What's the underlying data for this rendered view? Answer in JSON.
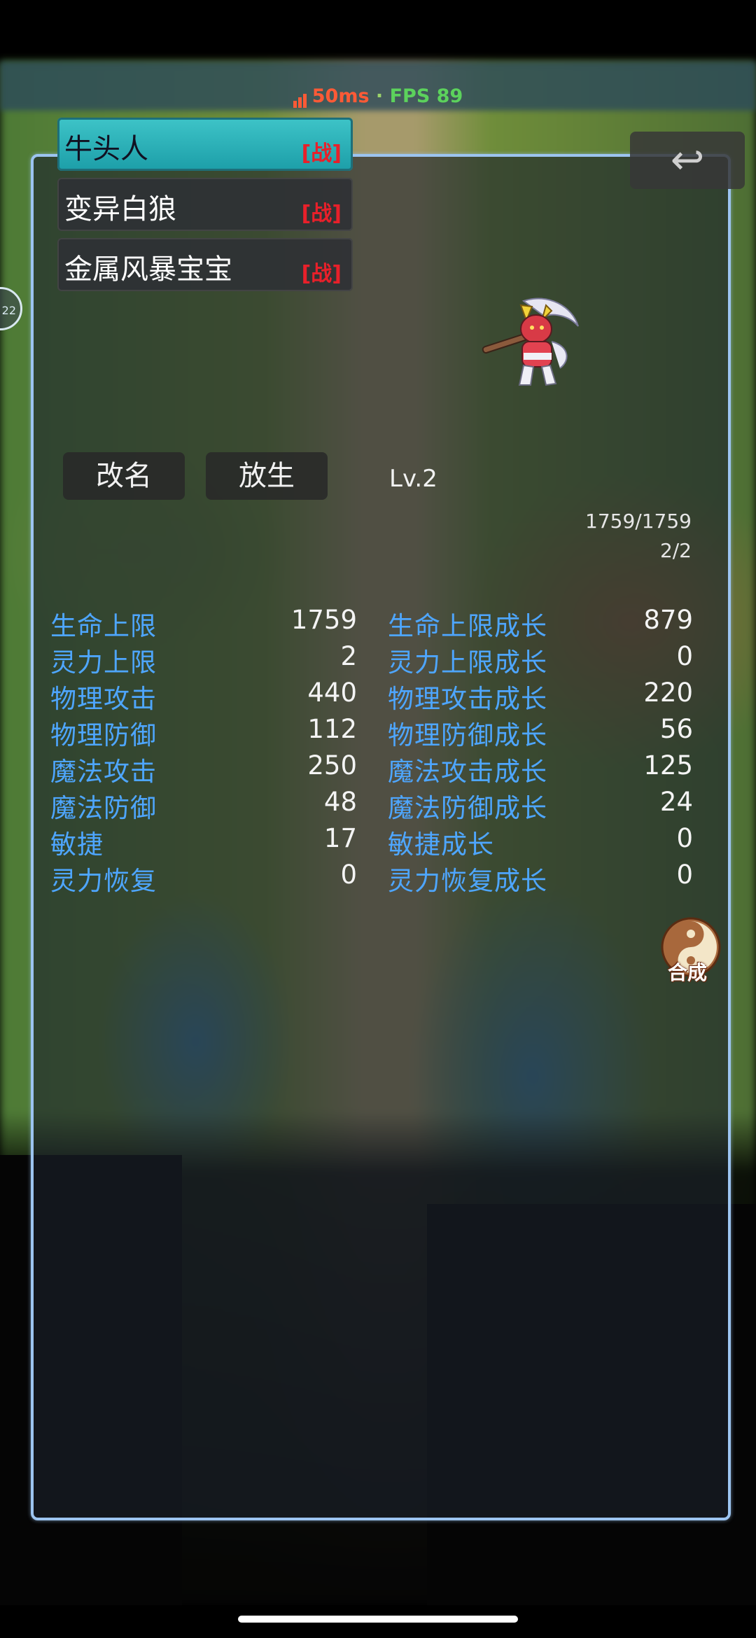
{
  "status": {
    "ping": "50ms",
    "separator": " · ",
    "fps": "FPS 89"
  },
  "pets": [
    {
      "name": "牛头人",
      "tag": "[战]",
      "active": true
    },
    {
      "name": "变异白狼",
      "tag": "[战]",
      "active": false
    },
    {
      "name": "金属风暴宝宝",
      "tag": "[战]",
      "active": false
    }
  ],
  "back_icon": "↩",
  "actions": {
    "rename": "改名",
    "release": "放生"
  },
  "level": "Lv.2",
  "hp_text": "1759/1759",
  "mp_text": "2/2",
  "stats": [
    {
      "label": "生命上限",
      "value": "1759",
      "growth_label": "生命上限成长",
      "growth_value": "879"
    },
    {
      "label": "灵力上限",
      "value": "2",
      "growth_label": "灵力上限成长",
      "growth_value": "0"
    },
    {
      "label": "物理攻击",
      "value": "440",
      "growth_label": "物理攻击成长",
      "growth_value": "220"
    },
    {
      "label": "物理防御",
      "value": "112",
      "growth_label": "物理防御成长",
      "growth_value": "56"
    },
    {
      "label": "魔法攻击",
      "value": "250",
      "growth_label": "魔法攻击成长",
      "growth_value": "125"
    },
    {
      "label": "魔法防御",
      "value": "48",
      "growth_label": "魔法防御成长",
      "growth_value": "24"
    },
    {
      "label": "敏捷",
      "value": "17",
      "growth_label": "敏捷成长",
      "growth_value": "0"
    },
    {
      "label": "灵力恢复",
      "value": "0",
      "growth_label": "灵力恢复成长",
      "growth_value": "0"
    }
  ],
  "synth_label": "合成",
  "left_edge_label": "22",
  "colors": {
    "panel_border": "#9cc4f0",
    "stat_label": "#4ea6ff",
    "active_tab": "#2ab2ba",
    "battle_tag": "#e8202a"
  }
}
